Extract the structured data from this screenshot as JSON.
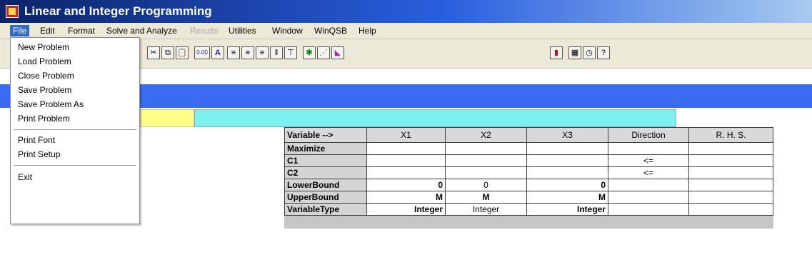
{
  "window": {
    "title": "Linear and Integer Programming"
  },
  "menubar": [
    {
      "label": "File",
      "state": "active"
    },
    {
      "label": "Edit",
      "state": "normal"
    },
    {
      "label": "Format",
      "state": "normal"
    },
    {
      "label": "Solve and Analyze",
      "state": "normal"
    },
    {
      "label": "Results",
      "state": "disabled"
    },
    {
      "label": "Utilities",
      "state": "normal"
    },
    {
      "label": "Window",
      "state": "normal"
    },
    {
      "label": "WinQSB",
      "state": "normal"
    },
    {
      "label": "Help",
      "state": "normal"
    }
  ],
  "file_menu": [
    {
      "label": "New Problem"
    },
    {
      "label": "Load Problem"
    },
    {
      "label": "Close Problem"
    },
    {
      "label": "Save Problem"
    },
    {
      "label": "Save Problem As"
    },
    {
      "label": "Print Problem"
    },
    {
      "separator": true
    },
    {
      "label": "Print Font"
    },
    {
      "label": "Print Setup"
    },
    {
      "separator": true
    },
    {
      "label": "Exit"
    }
  ],
  "toolbar_icons": [
    {
      "name": "cut-icon",
      "glyph": "✂"
    },
    {
      "name": "copy-icon",
      "glyph": "⧉"
    },
    {
      "name": "paste-icon",
      "glyph": "📋"
    },
    {
      "name": "number-format-icon",
      "glyph": "0.00"
    },
    {
      "name": "font-icon",
      "glyph": "A"
    },
    {
      "name": "align-left-icon",
      "glyph": "≡"
    },
    {
      "name": "align-center-icon",
      "glyph": "≡"
    },
    {
      "name": "align-right-icon",
      "glyph": "≡"
    },
    {
      "name": "column-width-icon",
      "glyph": "‖"
    },
    {
      "name": "row-height-icon",
      "glyph": "⊤"
    },
    {
      "name": "solve-icon",
      "glyph": "✱"
    },
    {
      "name": "graph-icon",
      "glyph": "⋰"
    },
    {
      "name": "chart-icon",
      "glyph": "◣"
    },
    {
      "name": "bar-chart-icon",
      "glyph": "▮"
    },
    {
      "name": "calculator-icon",
      "glyph": "▦"
    },
    {
      "name": "clock-icon",
      "glyph": "◷"
    },
    {
      "name": "help-icon",
      "glyph": "?"
    }
  ],
  "grid": {
    "header": [
      "Variable -->",
      "X1",
      "X2",
      "X3",
      "Direction",
      "R. H. S."
    ],
    "rows": [
      {
        "label": "Maximize",
        "cells": [
          "",
          "",
          "",
          "",
          ""
        ]
      },
      {
        "label": "C1",
        "cells": [
          "",
          "",
          "",
          "<=",
          ""
        ]
      },
      {
        "label": "C2",
        "cells": [
          "",
          "",
          "",
          "<=",
          ""
        ]
      },
      {
        "label": "LowerBound",
        "cells": [
          "0",
          "0",
          "0",
          "",
          ""
        ]
      },
      {
        "label": "UpperBound",
        "cells": [
          "M",
          "M",
          "M",
          "",
          ""
        ]
      },
      {
        "label": "VariableType",
        "cells": [
          "Integer",
          "Integer",
          "Integer",
          "",
          ""
        ]
      }
    ]
  }
}
